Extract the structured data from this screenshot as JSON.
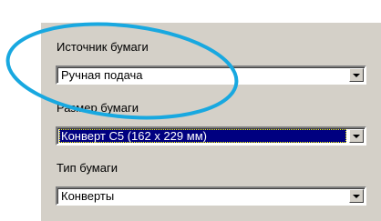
{
  "paper_source": {
    "label": "Источник бумаги",
    "value": "Ручная подача"
  },
  "paper_size": {
    "label": "Размер бумаги",
    "value": "Конверт C5 (162 x 229 мм)"
  },
  "paper_type": {
    "label": "Тип бумаги",
    "value": "Конверты"
  },
  "colors": {
    "dialog_background": "#d4d0c8",
    "selection_highlight": "#000080",
    "annotation_ellipse": "#18a8e0"
  },
  "icons": {
    "dropdown": "chevron-down-icon"
  }
}
